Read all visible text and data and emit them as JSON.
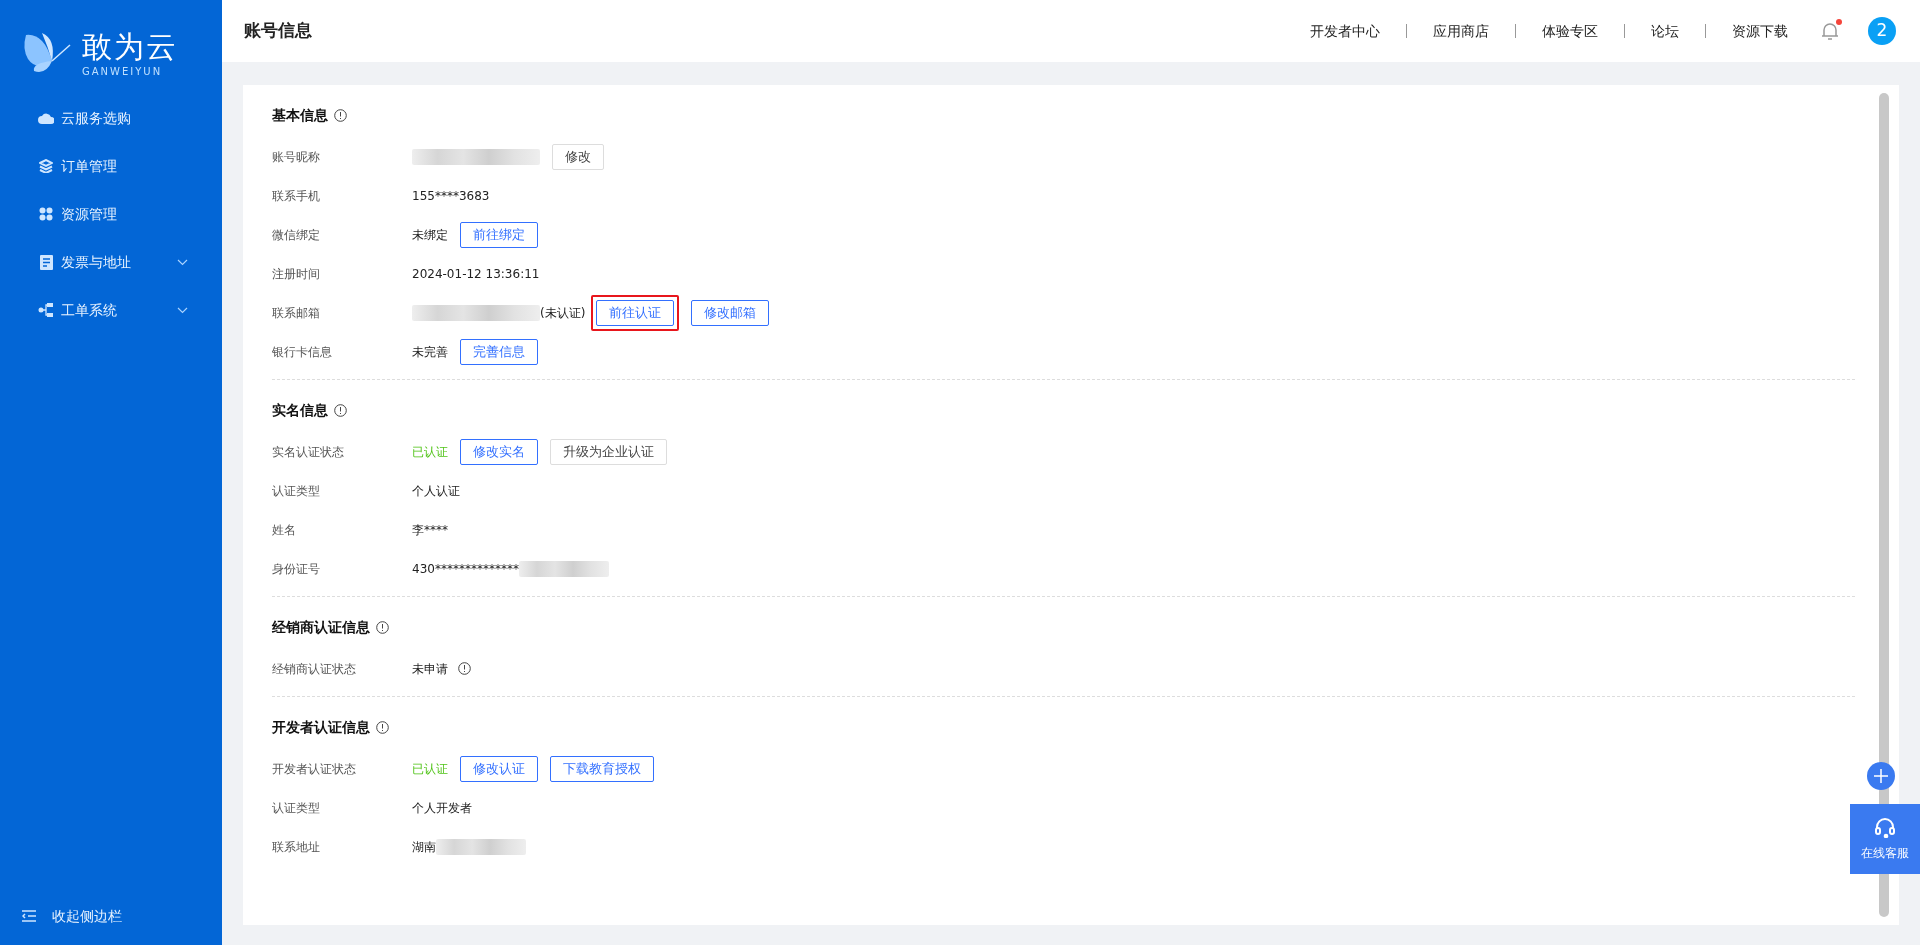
{
  "brand": {
    "name": "敢为云",
    "subtitle": "GANWEIYUN"
  },
  "sidebar": {
    "items": [
      {
        "label": "云服务选购",
        "expandable": false
      },
      {
        "label": "订单管理",
        "expandable": false
      },
      {
        "label": "资源管理",
        "expandable": false
      },
      {
        "label": "发票与地址",
        "expandable": true
      },
      {
        "label": "工单系统",
        "expandable": true
      }
    ],
    "collapse_label": "收起侧边栏"
  },
  "header": {
    "title": "账号信息",
    "links": [
      "开发者中心",
      "应用商店",
      "体验专区",
      "论坛",
      "资源下载"
    ],
    "notifications_unread": true,
    "avatar": "2"
  },
  "sections": [
    {
      "title": "基本信息",
      "rows": [
        {
          "label": "账号昵称",
          "kind": "masked",
          "buttons": [
            {
              "label": "修改",
              "kind": "plain",
              "highlighted": false
            }
          ]
        },
        {
          "label": "联系手机",
          "value": "155****3683",
          "kind": "plain"
        },
        {
          "label": "微信绑定",
          "value": "未绑定",
          "kind": "plain",
          "buttons": [
            {
              "label": "前往绑定",
              "kind": "primary",
              "highlighted": false
            }
          ]
        },
        {
          "label": "注册时间",
          "value": "2024-01-12 13:36:11",
          "kind": "plain"
        },
        {
          "label": "联系邮箱",
          "value": "(未认证)",
          "kind": "masked_prefix",
          "buttons": [
            {
              "label": "前往认证",
              "kind": "primary",
              "highlighted": true
            },
            {
              "label": "修改邮箱",
              "kind": "primary",
              "highlighted": false
            }
          ]
        },
        {
          "label": "银行卡信息",
          "value": "未完善",
          "kind": "plain",
          "buttons": [
            {
              "label": "完善信息",
              "kind": "primary",
              "highlighted": false
            }
          ]
        }
      ]
    },
    {
      "title": "实名信息",
      "rows": [
        {
          "label": "实名认证状态",
          "value": "已认证",
          "kind": "status",
          "buttons": [
            {
              "label": "修改实名",
              "kind": "primary",
              "highlighted": false
            },
            {
              "label": "升级为企业认证",
              "kind": "plain",
              "highlighted": false
            }
          ]
        },
        {
          "label": "认证类型",
          "value": "个人认证",
          "kind": "plain"
        },
        {
          "label": "姓名",
          "value": "李****",
          "kind": "plain"
        },
        {
          "label": "身份证号",
          "value": "430**************",
          "kind": "masked_suffix"
        }
      ]
    },
    {
      "title": "经销商认证信息",
      "rows": [
        {
          "label": "经销商认证状态",
          "value": "未申请",
          "kind": "plain",
          "info_icon": true
        }
      ]
    },
    {
      "title": "开发者认证信息",
      "rows": [
        {
          "label": "开发者认证状态",
          "value": "已认证",
          "kind": "status",
          "buttons": [
            {
              "label": "修改认证",
              "kind": "primary",
              "highlighted": false
            },
            {
              "label": "下载教育授权",
              "kind": "primary",
              "highlighted": false
            }
          ]
        },
        {
          "label": "认证类型",
          "value": "个人开发者",
          "kind": "plain"
        },
        {
          "label": "联系地址",
          "value": "湖南",
          "kind": "masked_suffix"
        }
      ]
    }
  ],
  "support": {
    "label": "在线客服"
  }
}
